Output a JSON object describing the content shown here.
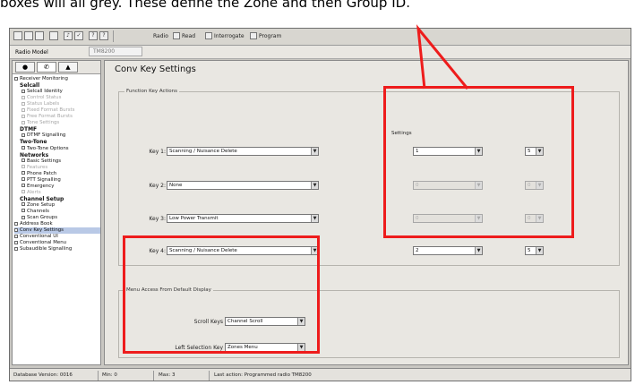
{
  "caption": "boxes will all grey. These define the Zone and then Group ID.",
  "toolbar": {
    "radio_label": "Radio",
    "read_label": "Read",
    "interrogate_label": "Interrogate",
    "program_label": "Program"
  },
  "model_row": {
    "label": "Radio Model",
    "value": "TM8200"
  },
  "sidebar": {
    "items": [
      {
        "label": "Receiver Monitoring",
        "style": "normal"
      },
      {
        "label": "Selcall",
        "style": "bold"
      },
      {
        "label": "Selcall Identity",
        "style": "normal"
      },
      {
        "label": "Control Status",
        "style": "grey"
      },
      {
        "label": "Status Labels",
        "style": "grey"
      },
      {
        "label": "Fixed Format Bursts",
        "style": "grey"
      },
      {
        "label": "Free Format Bursts",
        "style": "grey"
      },
      {
        "label": "Tone Settings",
        "style": "grey"
      },
      {
        "label": "DTMF",
        "style": "bold"
      },
      {
        "label": "DTMF Signalling",
        "style": "normal"
      },
      {
        "label": "Two-Tone",
        "style": "bold"
      },
      {
        "label": "Two-Tone Options",
        "style": "normal"
      },
      {
        "label": "Networks",
        "style": "bold"
      },
      {
        "label": "Basic Settings",
        "style": "normal"
      },
      {
        "label": "Features",
        "style": "grey"
      },
      {
        "label": "Phone Patch",
        "style": "normal"
      },
      {
        "label": "PTT Signalling",
        "style": "normal"
      },
      {
        "label": "Emergency",
        "style": "normal"
      },
      {
        "label": "Alerts",
        "style": "grey"
      },
      {
        "label": "Channel Setup",
        "style": "bold"
      },
      {
        "label": "Zone Setup",
        "style": "normal"
      },
      {
        "label": "Channels",
        "style": "normal"
      },
      {
        "label": "Scan Groups",
        "style": "normal"
      },
      {
        "label": "Address Book",
        "style": "normal"
      },
      {
        "label": "Conv Key Settings",
        "style": "selected"
      },
      {
        "label": "Conventional UI",
        "style": "normal"
      },
      {
        "label": "Conventional Menu",
        "style": "normal"
      },
      {
        "label": "Subaudible Signalling",
        "style": "normal"
      }
    ]
  },
  "main": {
    "title": "Conv Key Settings",
    "function_keys": {
      "group_label": "Function Key Actions",
      "settings_label": "Settings",
      "keys": [
        {
          "label": "Key 1:",
          "action": "Scanning / Nuisance Delete",
          "setting1": "1",
          "setting2": "5",
          "enabled": true
        },
        {
          "label": "Key 2:",
          "action": "None",
          "setting1": "0",
          "setting2": "0",
          "enabled": false
        },
        {
          "label": "Key 3:",
          "action": "Low Power Transmit",
          "setting1": "0",
          "setting2": "0",
          "enabled": false
        },
        {
          "label": "Key 4:",
          "action": "Scanning / Nuisance Delete",
          "setting1": "2",
          "setting2": "5",
          "enabled": true
        }
      ]
    },
    "menu_access": {
      "group_label": "Menu Access From Default Display",
      "scroll_keys_label": "Scroll Keys",
      "scroll_keys_value": "Channel Scroll",
      "left_selection_label": "Left Selection Key",
      "left_selection_value": "Zones Menu"
    }
  },
  "status_bar": {
    "database_version": "Database Version: 0016",
    "min": "Min: 0",
    "max": "Max: 3",
    "last_action": "Last action: Programmed radio TM8200"
  },
  "colors": {
    "highlight": "#ee1c1c",
    "window_bg": "#c9c7c2",
    "panel_bg": "#e9e7e2"
  }
}
